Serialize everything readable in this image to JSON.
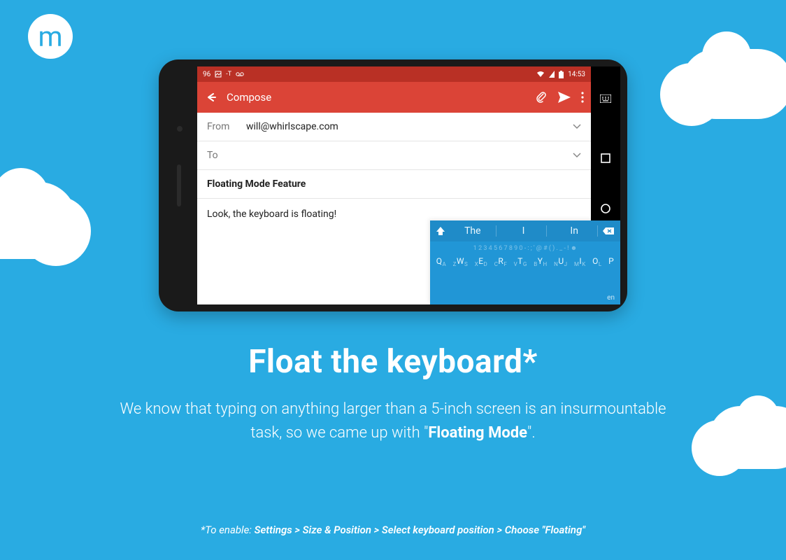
{
  "logo_letter": "m",
  "status": {
    "battery_pct": "96",
    "time": "14:53"
  },
  "appbar": {
    "title": "Compose"
  },
  "fields": {
    "from_label": "From",
    "from_value": "will@whirlscape.com",
    "to_label": "To",
    "subject": "Floating Mode Feature",
    "body": "Look, the keyboard is floating!"
  },
  "keyboard": {
    "suggestions": [
      "The",
      "I",
      "In"
    ],
    "number_row": "1 2 3 4 5 6 7 8 9 0 - : ; ' @ # ( ) . _ - ! ☻",
    "letters": [
      "Q",
      "A",
      "Z",
      "W",
      "S",
      "X",
      "E",
      "D",
      "C",
      "R",
      "F",
      "V",
      "T",
      "G",
      "B",
      "Y",
      "H",
      "N",
      "U",
      "J",
      "M",
      "I",
      "K",
      "O",
      "L",
      "P"
    ],
    "lang": "en"
  },
  "hero": {
    "title": "Float the keyboard*",
    "body_pre": "We know that typing on anything larger than a 5-inch screen is an insurmountable task, so we came up with \"",
    "body_bold": "Floating Mode",
    "body_post": "\"."
  },
  "footnote": {
    "prefix": "*To enable: ",
    "path": "Settings > Size & Position > Select keyboard position > Choose \"Floating\""
  },
  "colors": {
    "bg": "#29abe2",
    "appbar": "#db4437",
    "statusbar": "#b93025",
    "keyboard": "#2196d6"
  }
}
